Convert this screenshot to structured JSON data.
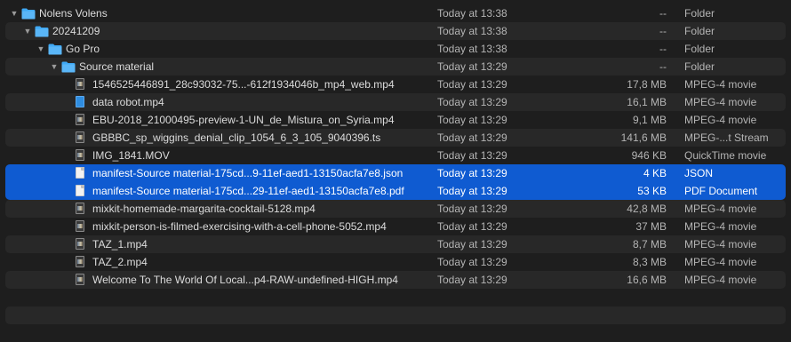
{
  "rows": [
    {
      "name": "Nolens Volens",
      "date": "Today at 13:38",
      "size": "--",
      "kind": "Folder"
    },
    {
      "name": "20241209",
      "date": "Today at 13:38",
      "size": "--",
      "kind": "Folder"
    },
    {
      "name": "Go Pro",
      "date": "Today at 13:38",
      "size": "--",
      "kind": "Folder"
    },
    {
      "name": "Source material",
      "date": "Today at 13:29",
      "size": "--",
      "kind": "Folder"
    },
    {
      "name": "1546525446891_28c93032-75...-612f1934046b_mp4_web.mp4",
      "date": "Today at 13:29",
      "size": "17,8 MB",
      "kind": "MPEG-4 movie"
    },
    {
      "name": "data robot.mp4",
      "date": "Today at 13:29",
      "size": "16,1 MB",
      "kind": "MPEG-4 movie"
    },
    {
      "name": "EBU-2018_21000495-preview-1-UN_de_Mistura_on_Syria.mp4",
      "date": "Today at 13:29",
      "size": "9,1 MB",
      "kind": "MPEG-4 movie"
    },
    {
      "name": "GBBBC_sp_wiggins_denial_clip_1054_6_3_105_9040396.ts",
      "date": "Today at 13:29",
      "size": "141,6 MB",
      "kind": "MPEG-...t Stream"
    },
    {
      "name": "IMG_1841.MOV",
      "date": "Today at 13:29",
      "size": "946 KB",
      "kind": "QuickTime movie"
    },
    {
      "name": "manifest-Source material-175cd...9-11ef-aed1-13150acfa7e8.json",
      "date": "Today at 13:29",
      "size": "4 KB",
      "kind": "JSON"
    },
    {
      "name": "manifest-Source material-175cd...29-11ef-aed1-13150acfa7e8.pdf",
      "date": "Today at 13:29",
      "size": "53 KB",
      "kind": "PDF Document"
    },
    {
      "name": "mixkit-homemade-margarita-cocktail-5128.mp4",
      "date": "Today at 13:29",
      "size": "42,8 MB",
      "kind": "MPEG-4 movie"
    },
    {
      "name": "mixkit-person-is-filmed-exercising-with-a-cell-phone-5052.mp4",
      "date": "Today at 13:29",
      "size": "37 MB",
      "kind": "MPEG-4 movie"
    },
    {
      "name": "TAZ_1.mp4",
      "date": "Today at 13:29",
      "size": "8,7 MB",
      "kind": "MPEG-4 movie"
    },
    {
      "name": "TAZ_2.mp4",
      "date": "Today at 13:29",
      "size": "8,3 MB",
      "kind": "MPEG-4 movie"
    },
    {
      "name": "Welcome To The World Of Local...p4-RAW-undefined-HIGH.mp4",
      "date": "Today at 13:29",
      "size": "16,6 MB",
      "kind": "MPEG-4 movie"
    }
  ],
  "icons": {
    "disclosure": "chevron-down-icon",
    "folder": "folder-icon",
    "video": "video-file-icon",
    "document": "document-file-icon"
  },
  "colors": {
    "background": "#1e1e1e",
    "alternate_row": "#282828",
    "selection": "#0f5bd1",
    "folder": "#3fa9f5"
  }
}
